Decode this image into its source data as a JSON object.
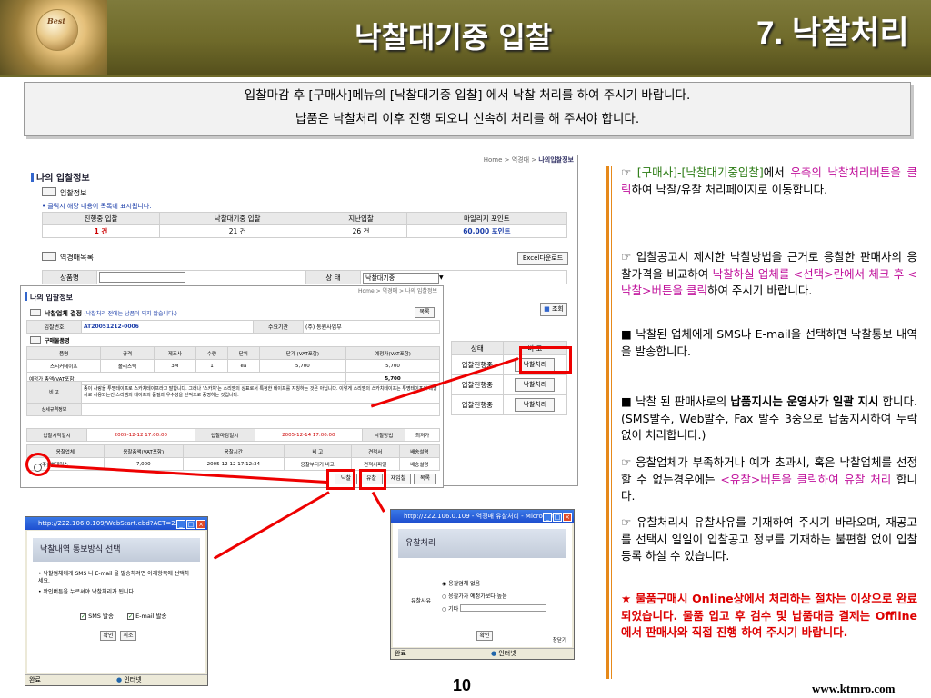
{
  "header": {
    "title": "낙찰대기중 입찰",
    "section": "7. 낙찰처리",
    "logo_text": "Best"
  },
  "notice": {
    "line1": "입찰마감 후 [구매사]메뉴의 [낙찰대기중 입찰] 에서 낙찰 처리를 하여 주시기 바랍니다.",
    "line2": "납품은 낙찰처리 이후 진행 되오니 신속히 처리를 해 주셔야 합니다."
  },
  "shot1": {
    "breadcrumb": "Home > 역경매 >",
    "breadcrumb_current": "나의입찰정보",
    "title": "나의 입찰정보",
    "section_bid": "입찰정보",
    "hint": "• 클릭시 해당 내용이 목록에 표시됩니다.",
    "summary_headers": [
      "진행중 입찰",
      "낙찰대기중 입찰",
      "지난입찰",
      "마일리지 포인트"
    ],
    "summary_values": [
      "1 건",
      "21 건",
      "26 건",
      "60,000 포인트"
    ],
    "section_list": "역경매목록",
    "excel": "Excel다운로드",
    "product_label": "상품명",
    "status_label": "상 태",
    "status_value": "낙찰대기중",
    "search": "조회",
    "col_status": "상태",
    "col_note": "비 고",
    "rows": [
      {
        "status": "입찰진행중",
        "action": "낙찰처리"
      },
      {
        "status": "입찰진행중",
        "action": "낙찰처리"
      },
      {
        "status": "입찰진행중",
        "action": "낙찰처리"
      }
    ]
  },
  "shot2": {
    "title": "나의 입찰정보",
    "breadcrumb": "Home > 역경매 > 나의 입찰정보",
    "sec_result": "낙찰업체 결정",
    "sec_result_note": "(낙찰처리 전에는 납품이 되지 않습니다.)",
    "list_btn": "목록",
    "bid_no_label": "입찰번호",
    "bid_no": "AT20051212-0006",
    "org_label": "수요기관",
    "org_value": "(주) 동원사업부",
    "sec_items": "구매물품명",
    "item_headers": [
      "품명",
      "규격",
      "제조사",
      "수량",
      "단위",
      "단가 (VAT포함)",
      "예정가(VAT포함)"
    ],
    "item_row": [
      "스티커테이프",
      "폴리스틱",
      "3M",
      "1",
      "ea",
      "5,700",
      "5,700"
    ],
    "estimate_label": "예정가 총액(VAT포함)",
    "estimate_value": "5,700",
    "note_label": "비 고",
    "note_text": "종이 사랑을 투명테이프로 스카치테이프라고 말합니다. 그러나 '스카치'는 스리엠의 상표로서 특정한 테이프를 지칭하는 것은 아닙니다. 이렇게 스리엠의 스카치테이프는 투명테이프의 대명사로 사용되는건 스리엠의 테이프의 품질과 우수성을 단적으로 증명하는 것입니다.",
    "spec_label": "상세규격정보",
    "start_label": "입찰시작일시",
    "start_value": "2005-12-12 17:00:00",
    "end_label": "입찰마감일시",
    "end_value": "2005-12-14 17:00:00",
    "method_label": "낙찰방법",
    "method_value": "최저가",
    "bid_headers": [
      "응찰업체",
      "응찰총액(VAT포함)",
      "응찰시간",
      "비 고",
      "견적서",
      "배송설명"
    ],
    "bid_row": [
      "(주) 뽀데믹스",
      "7,000",
      "2005-12-12 17:12:34",
      "응찰부터기 비고",
      "견적서파일",
      "배송설명"
    ],
    "btn_award": "낙찰",
    "btn_fail": "유찰",
    "btn_rebid": "재입찰",
    "btn_list": "목록"
  },
  "win1": {
    "title": "http://222.106.0.109/WebStart.ebd?ACT=2...",
    "heading": "낙찰내역 통보방식 선택",
    "bullet1": "• 낙찰업체에게 SMS 나 E-mail 을 발송하려면 아래항목에 선택하세요.",
    "bullet2": "• 확인버튼을 누르셔야 낙찰처리가 됩니다.",
    "sms": "SMS 발송",
    "email": "E-mail 발송",
    "ok": "확인",
    "cancel": "취소",
    "status_left": "완료",
    "status_right": "인터넷"
  },
  "win2": {
    "title": "http://222.106.0.109 - 역경매 유찰처리 - Microsoft...",
    "heading": "유찰처리",
    "reason_label": "유찰사유",
    "opt1": "응찰업체 없음",
    "opt2": "응찰가가 예정가보다 높음",
    "opt3": "기타",
    "ok": "확인",
    "close": "창닫기",
    "status_left": "완료",
    "status_right": "인터넷"
  },
  "right": {
    "p1a": "☞ ",
    "p1b": "[구매사]-[낙찰대기중입찰]",
    "p1c": "에서 ",
    "p1d": "우측의 낙찰처리버튼을 클릭",
    "p1e": "하여 낙찰/유찰 처리페이지로 이동합니다.",
    "p2a": "☞ 입찰공고시 제시한 낙찰방법을 근거로 응찰한 판매사의 응찰가격을 비교하여 ",
    "p2b": "낙찰하실 업체를 <선택>란에서 체크 후 <낙찰>버튼을 클릭",
    "p2c": "하여 주시기 바랍니다.",
    "p3": "■ 낙찰된 업체에게 SMS나 E-mail을 선택하면 낙찰통보 내역을 발송합니다.",
    "p4a": "■ 낙찰 된 판매사로의 ",
    "p4b": "납품지시는 운영사가 일괄 지시",
    "p4c": " 합니다.(SMS발주, Web발주, Fax 발주 3중으로 납품지시하여 누락없이 처리합니다.)",
    "p5a": "☞ 응찰업체가 부족하거나 예가 초과시, 혹은 낙찰업체를 선정 할 수 없는경우에는 ",
    "p5b": "<유찰>버튼을 클릭하여 유찰 처리",
    "p5c": " 합니다.",
    "p6": "☞ 유찰처리시 유찰사유를 기재하여 주시기 바라오며, 재공고를 선택시 일일이 입찰공고 정보를 기재하는 불편함 없이 입찰등록 하실 수 있습니다.",
    "p7": "★ 물품구매시 Online상에서 처리하는 절차는 이상으로 완료 되었습니다. 물품 입고 후 검수 및 납품대금 결제는 Offline에서 판매사와 직접 진행 하여 주시기 바랍니다."
  },
  "footer": {
    "page": "10",
    "url": "www.ktmro.com"
  },
  "colors": {
    "header": "#6f6a2a",
    "accent_bar": "#e6891a",
    "highlight_red": "#e00000",
    "green": "#2a7a12",
    "magenta": "#c0109b"
  }
}
